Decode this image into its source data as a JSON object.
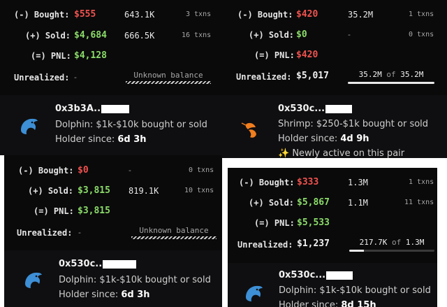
{
  "panels": {
    "tl": {
      "bought_label": "(-) Bought:",
      "bought_value": "$555",
      "bought_amount": "643.1K",
      "bought_txns": "3 txns",
      "sold_label": "(+) Sold:",
      "sold_value": "$4,684",
      "sold_amount": "666.5K",
      "sold_txns": "16 txns",
      "pnl_label": "(=) PNL:",
      "pnl_value": "$4,128",
      "unrealized_label": "Unrealized:",
      "unrealized_value": "-",
      "balance_text": "Unknown balance",
      "trader": {
        "address": "0x3b3A..",
        "tier": "Dolphin: $1k-$10k bought or sold",
        "holder_label": "Holder since: ",
        "holder_value": "6d 3h",
        "icon": "dolphin-icon"
      }
    },
    "tr": {
      "bought_label": "(-) Bought:",
      "bought_value": "$420",
      "bought_amount": "35.2M",
      "bought_txns": "1 txns",
      "sold_label": "(+) Sold:",
      "sold_value": "$0",
      "sold_amount": "-",
      "sold_txns": "0 txns",
      "pnl_label": "(=) PNL:",
      "pnl_value": "$420",
      "unrealized_label": "Unrealized:",
      "unrealized_value": "$5,017",
      "balance_current": "35.2M",
      "balance_of": "of",
      "balance_total": "35.2M",
      "balance_fraction": 1.0,
      "trader": {
        "address": "0x530c...",
        "tier": "Shrimp: $250-$1k bought or sold",
        "holder_label": "Holder since: ",
        "holder_value": "4d 9h",
        "extra": "✨ Newly active on this pair",
        "icon": "shrimp-icon"
      }
    },
    "bl": {
      "bought_label": "(-) Bought:",
      "bought_value": "$0",
      "bought_amount": "-",
      "bought_txns": "0 txns",
      "sold_label": "(+) Sold:",
      "sold_value": "$3,815",
      "sold_amount": "819.1K",
      "sold_txns": "10 txns",
      "pnl_label": "(=) PNL:",
      "pnl_value": "$3,815",
      "unrealized_label": "Unrealized:",
      "unrealized_value": "-",
      "balance_text": "Unknown balance",
      "trader": {
        "address": "0x530c..",
        "tier": "Dolphin: $1k-$10k bought or sold",
        "holder_label": "Holder since: ",
        "holder_value": "6d 3h",
        "icon": "dolphin-icon"
      }
    },
    "br": {
      "bought_label": "(-) Bought:",
      "bought_value": "$333",
      "bought_amount": "1.3M",
      "bought_txns": "1 txns",
      "sold_label": "(+) Sold:",
      "sold_value": "$5,867",
      "sold_amount": "1.1M",
      "sold_txns": "11 txns",
      "pnl_label": "(=) PNL:",
      "pnl_value": "$5,533",
      "unrealized_label": "Unrealized:",
      "unrealized_value": "$1,237",
      "balance_current": "217.7K",
      "balance_of": "of",
      "balance_total": "1.3M",
      "balance_fraction": 0.17,
      "trader": {
        "address": "0x530c...",
        "tier": "Dolphin: $1k-$10k bought or sold",
        "holder_label": "Holder since: ",
        "holder_value": "8d 15h",
        "icon": "dolphin-icon"
      }
    }
  },
  "colors": {
    "negative": "#f0524f",
    "positive": "#8bdc6a",
    "panel_bg": "#0a0a0a",
    "card_bg": "#0f0f11",
    "shrimp": "#f07d1e",
    "dolphin": "#3d8fd6"
  }
}
